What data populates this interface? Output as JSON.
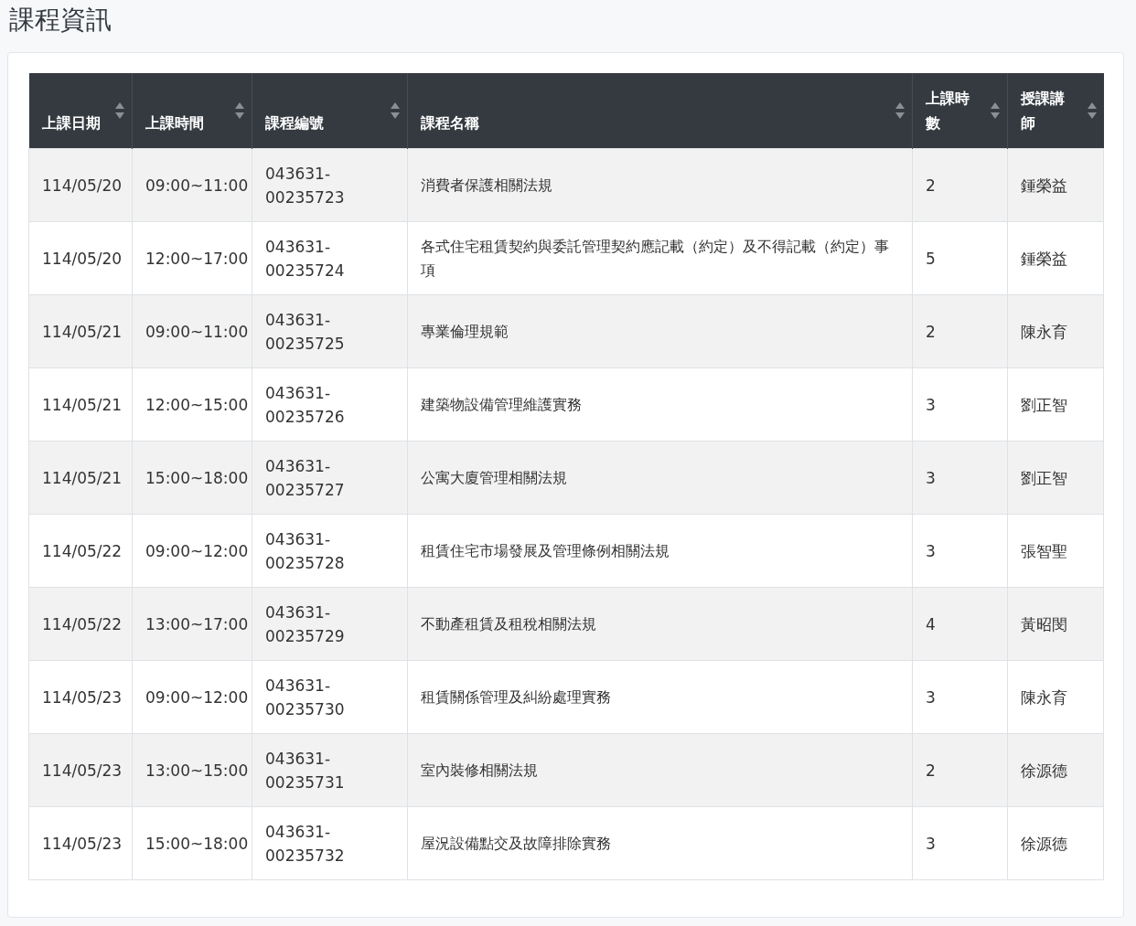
{
  "page_title": "課程資訊",
  "table": {
    "columns": [
      "上課日期",
      "上課時間",
      "課程編號",
      "課程名稱",
      "上課時數",
      "授課講師"
    ],
    "rows": [
      [
        "114/05/20",
        "09:00~11:00",
        "043631-00235723",
        "消費者保護相關法規",
        "2",
        "鍾榮益"
      ],
      [
        "114/05/20",
        "12:00~17:00",
        "043631-00235724",
        "各式住宅租賃契約與委託管理契約應記載（約定）及不得記載（約定）事項",
        "5",
        "鍾榮益"
      ],
      [
        "114/05/21",
        "09:00~11:00",
        "043631-00235725",
        "專業倫理規範",
        "2",
        "陳永育"
      ],
      [
        "114/05/21",
        "12:00~15:00",
        "043631-00235726",
        "建築物設備管理維護實務",
        "3",
        "劉正智"
      ],
      [
        "114/05/21",
        "15:00~18:00",
        "043631-00235727",
        "公寓大廈管理相關法規",
        "3",
        "劉正智"
      ],
      [
        "114/05/22",
        "09:00~12:00",
        "043631-00235728",
        "租賃住宅市場發展及管理條例相關法規",
        "3",
        "張智聖"
      ],
      [
        "114/05/22",
        "13:00~17:00",
        "043631-00235729",
        "不動產租賃及租稅相關法規",
        "4",
        "黃昭閔"
      ],
      [
        "114/05/23",
        "09:00~12:00",
        "043631-00235730",
        "租賃關係管理及糾紛處理實務",
        "3",
        "陳永育"
      ],
      [
        "114/05/23",
        "13:00~15:00",
        "043631-00235731",
        "室內裝修相關法規",
        "2",
        "徐源德"
      ],
      [
        "114/05/23",
        "15:00~18:00",
        "043631-00235732",
        "屋況設備點交及故障排除實務",
        "3",
        "徐源德"
      ]
    ]
  }
}
